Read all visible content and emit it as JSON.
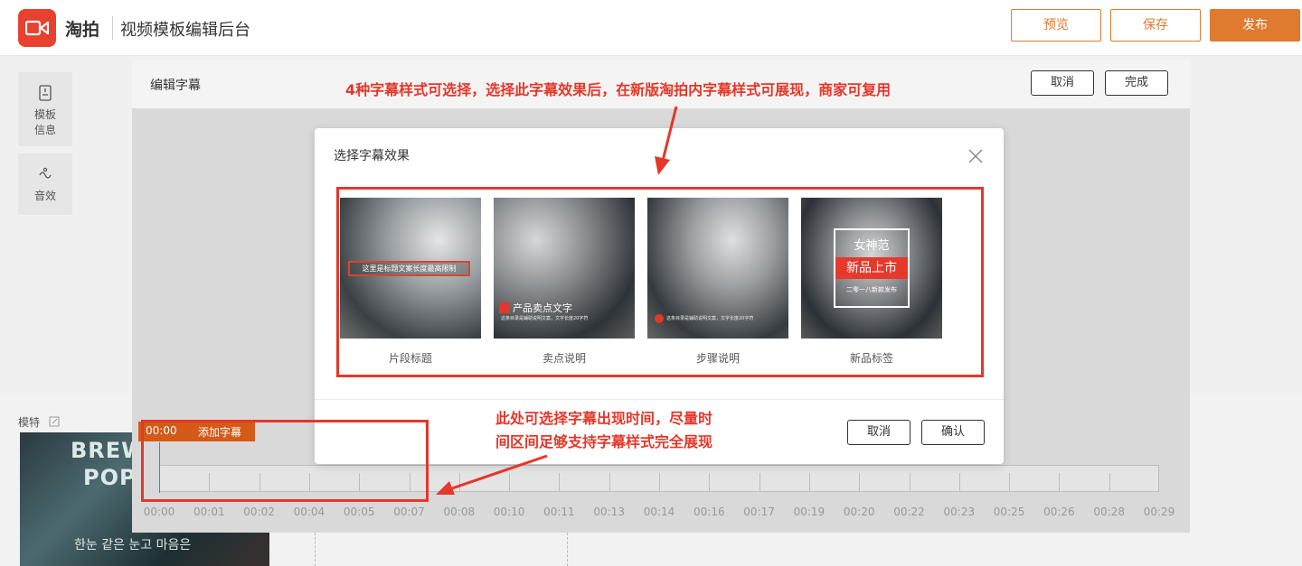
{
  "header": {
    "brand": "淘拍",
    "subtitle": "视频模板编辑后台",
    "preview_label": "预览",
    "save_label": "保存",
    "publish_label": "发布"
  },
  "rail": {
    "items": [
      {
        "label": "模板\n信息",
        "line1": "模板",
        "line2": "信息",
        "icon": "template-info-icon"
      },
      {
        "label": "音效",
        "icon": "sound-effect-icon"
      }
    ]
  },
  "editor": {
    "title": "编辑字幕",
    "cancel_label": "取消",
    "done_label": "完成"
  },
  "model": {
    "label": "模特",
    "thumb_line1": "BREW",
    "thumb_line2": "POP",
    "thumb_line3": "한눈 같은 눈고 마음은"
  },
  "timeline": {
    "current_time": "00:00",
    "add_label": "添加字幕",
    "labels": [
      "00:00",
      "00:01",
      "00:02",
      "00:04",
      "00:05",
      "00:07",
      "00:08",
      "00:10",
      "00:11",
      "00:13",
      "00:14",
      "00:16",
      "00:17",
      "00:19",
      "00:20",
      "00:22",
      "00:23",
      "00:25",
      "00:26",
      "00:28",
      "00:29"
    ]
  },
  "modal": {
    "title": "选择字幕效果",
    "cancel_label": "取消",
    "confirm_label": "确认",
    "options": [
      {
        "caption": "片段标题",
        "overlay": "这里是标题文案长度最高限制"
      },
      {
        "caption": "卖点说明",
        "overlay_main": "产品卖点文字",
        "overlay_sub": "这条目录是辅助说明文案，文字长度20字符"
      },
      {
        "caption": "步骤说明",
        "overlay_sub": "这条目录是辅助说明文案，文字长度20字符"
      },
      {
        "caption": "新品标签",
        "overlay_line1": "女神范",
        "overlay_line2": "新品上市",
        "overlay_line3": "二零一八新款发布"
      }
    ]
  },
  "annotations": {
    "top_note": "4种字幕样式可选择，选择此字幕效果后，在新版淘拍内字幕样式可展现，商家可复用",
    "timeline_note_line1": "此处可选择字幕出现时间，尽量时",
    "timeline_note_line2": "间区间足够支持字幕样式完全展现"
  },
  "colors": {
    "accent": "#e07a2e",
    "annotation_red": "#e5372a",
    "logo_red": "#e8412f"
  }
}
